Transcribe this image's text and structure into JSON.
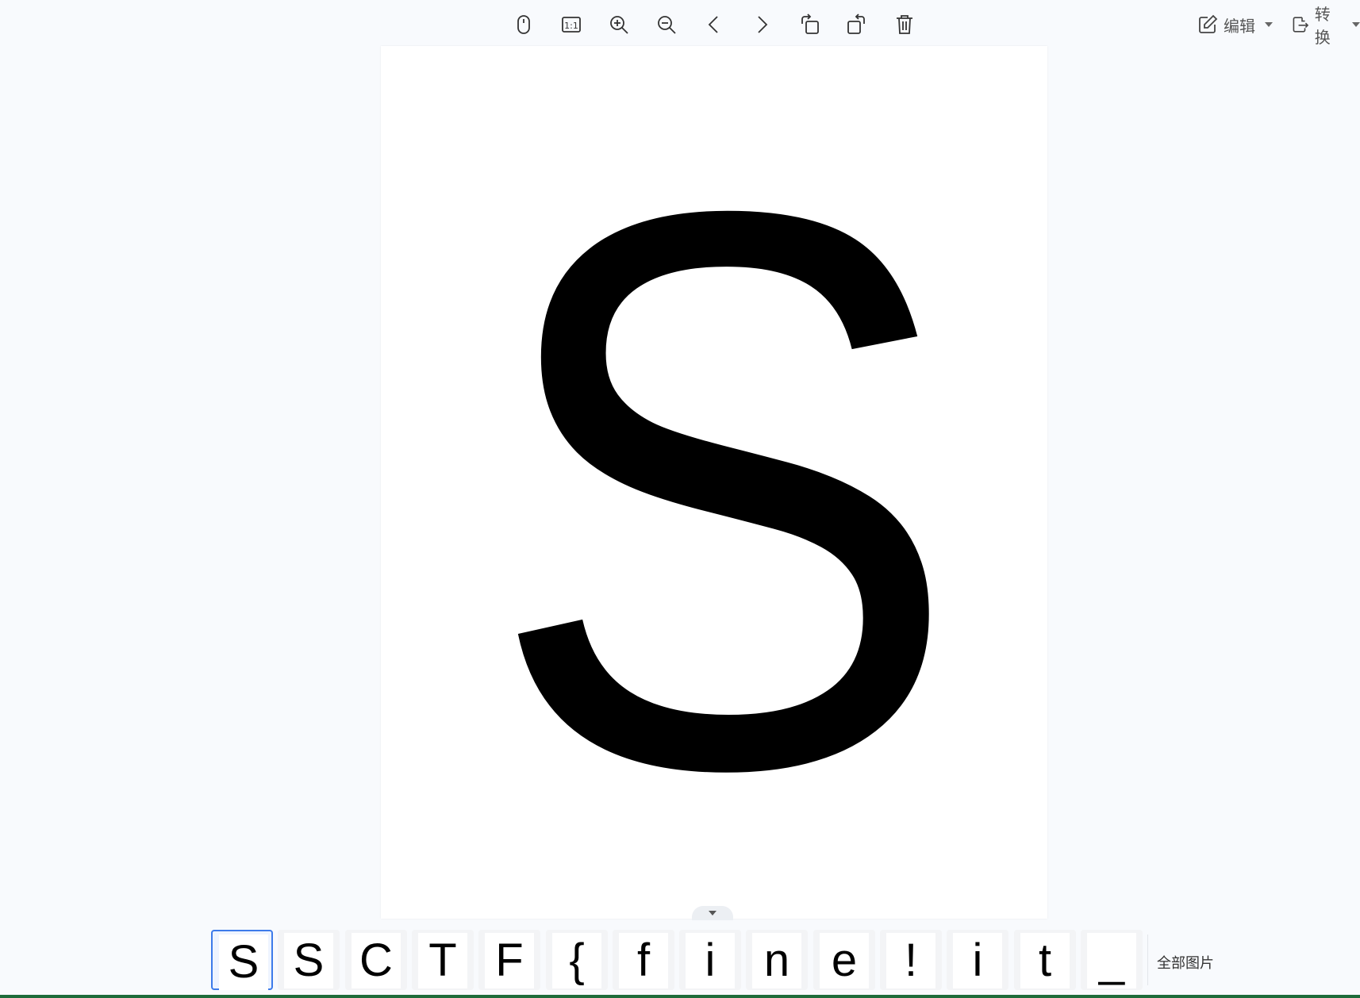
{
  "toolbar": {
    "tools": [
      {
        "name": "mouse-mode-icon",
        "label": "Mouse mode"
      },
      {
        "name": "actual-size-icon",
        "label": "1:1"
      },
      {
        "name": "zoom-in-icon",
        "label": "Zoom in"
      },
      {
        "name": "zoom-out-icon",
        "label": "Zoom out"
      },
      {
        "name": "previous-icon",
        "label": "Previous"
      },
      {
        "name": "next-icon",
        "label": "Next"
      },
      {
        "name": "rotate-left-icon",
        "label": "Rotate left"
      },
      {
        "name": "rotate-right-icon",
        "label": "Rotate right"
      },
      {
        "name": "delete-icon",
        "label": "Delete"
      }
    ],
    "actual_size_text": "1:1",
    "edit_label": "编辑",
    "convert_label": "转换"
  },
  "viewer": {
    "current_glyph": "S"
  },
  "thumbnails": {
    "items": [
      "S",
      "S",
      "C",
      "T",
      "F",
      "{",
      "f",
      "i",
      "n",
      "e",
      "!",
      "i",
      "t",
      "_"
    ],
    "active_index": 0,
    "all_images_label": "全部图片"
  },
  "colors": {
    "background": "#f8fafd",
    "accent": "#3d7bea",
    "icon": "#333333"
  }
}
